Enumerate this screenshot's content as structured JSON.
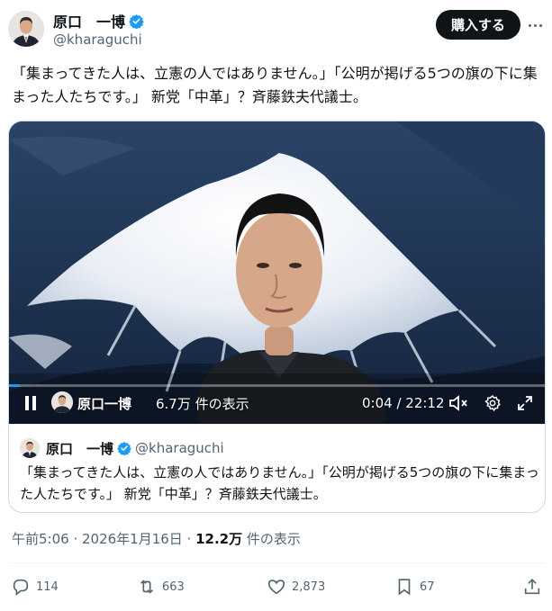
{
  "author": {
    "display_name": "原口　一博",
    "handle": "@kharaguchi",
    "avatar_icon": "person-avatar-icon",
    "verified_color": "#1d9bf0"
  },
  "header": {
    "buy_label": "購入する",
    "more_icon": "more-dots-icon"
  },
  "tweet": {
    "text": "「集まってきた人は、立憲の人ではありません。」「公明が掲げる5つの旗の下に集まった人たちです。」 新党「中革」？斉藤鉄夫代議士。"
  },
  "video": {
    "overlay_name": "原口一博",
    "overlay_views": "6.7万 件の表示",
    "time_readout": "0:04 / 22:12",
    "progress": 0.003,
    "accent": "#1d9bf0",
    "play_icon": "pause-icon",
    "mute_icon": "mute-icon",
    "settings_icon": "gear-icon",
    "fullscreen_icon": "fullscreen-icon"
  },
  "quote": {
    "display_name": "原口　一博",
    "handle": "@kharaguchi",
    "text": "「集まってきた人は、立憲の人ではありません。」「公明が掲げる5つの旗の下に集まった人たちです。」 新党「中革」？斉藤鉄夫代議士。"
  },
  "meta": {
    "timestamp": "午前5:06 · 2026年1月16日 · ",
    "views_count": "12.2万",
    "views_suffix": " 件の表示"
  },
  "actions": {
    "reply": {
      "icon": "reply-icon",
      "count": "114"
    },
    "repost": {
      "icon": "repost-icon",
      "count": "663"
    },
    "like": {
      "icon": "heart-icon",
      "count": "2,873"
    },
    "bookmark": {
      "icon": "bookmark-icon",
      "count": "67"
    },
    "share": {
      "icon": "share-icon"
    }
  }
}
